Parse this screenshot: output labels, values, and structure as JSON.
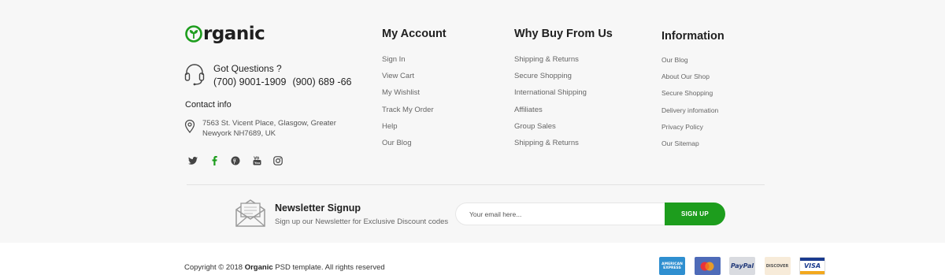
{
  "brand": {
    "logo_rest": "rganic",
    "accent": "#1d9d1d"
  },
  "support": {
    "title": "Got Questions ?",
    "phones": [
      "(700)  9001-1909",
      "(900) 689 -66"
    ]
  },
  "contact": {
    "title": "Contact info",
    "address": "7563 St. Vicent Place, Glasgow, Greater Newyork NH7689, UK"
  },
  "socials": [
    "twitter-icon",
    "facebook-icon",
    "pinterest-icon",
    "youtube-icon",
    "instagram-icon"
  ],
  "columns": {
    "account": {
      "title": "My Account",
      "items": [
        "Sign In",
        "View Cart",
        "My Wishlist",
        "Track My Order",
        "Help",
        "Our Blog"
      ]
    },
    "why": {
      "title": "Why Buy From Us",
      "items": [
        "Shipping & Returns",
        "Secure Shopping",
        "International Shipping",
        "Affiliates",
        "Group Sales",
        "Shipping & Returns"
      ]
    },
    "info": {
      "title": "Information",
      "items": [
        "Our Blog",
        "About Our Shop",
        "Secure Shopping",
        "Delivery infomation",
        "Privacy Policy",
        "Our Sitemap"
      ]
    }
  },
  "newsletter": {
    "title": "Newsletter Signup",
    "subtitle": "Sign up our Newsletter for Exclusive Discount codes",
    "placeholder": "Your email here...",
    "button": "SIGN UP"
  },
  "copyright": {
    "prefix": "Copyright © 2018",
    "brand": "Organic",
    "suffix": "PSD template. All rights reserved"
  },
  "payments": {
    "amex_line1": "AMERICAN",
    "amex_line2": "EXPRESS",
    "paypal": "PayPal",
    "discover": "DISCOVER",
    "visa": "VISA"
  }
}
